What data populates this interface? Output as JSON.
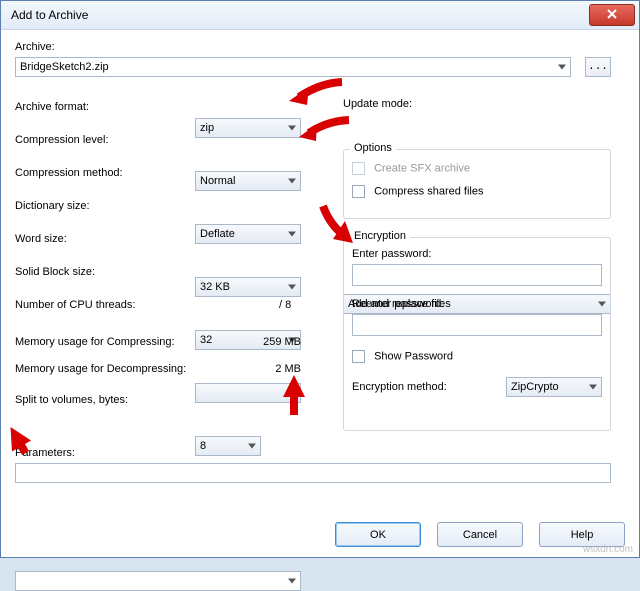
{
  "window": {
    "title": "Add to Archive"
  },
  "archive": {
    "label": "Archive:",
    "value": "BridgeSketch2.zip",
    "browse": "..."
  },
  "left": {
    "format_lbl": "Archive format:",
    "format_val": "zip",
    "level_lbl": "Compression level:",
    "level_val": "Normal",
    "method_lbl": "Compression method:",
    "method_val": "Deflate",
    "dict_lbl": "Dictionary size:",
    "dict_val": "32 KB",
    "word_lbl": "Word size:",
    "word_val": "32",
    "solid_lbl": "Solid Block size:",
    "solid_val": "",
    "cpu_lbl": "Number of CPU threads:",
    "cpu_val": "8",
    "cpu_max": "/ 8",
    "mem_c_lbl": "Memory usage for Compressing:",
    "mem_c_val": "259 MB",
    "mem_d_lbl": "Memory usage for Decompressing:",
    "mem_d_val": "2 MB",
    "split_lbl": "Split to volumes, bytes:",
    "split_val": "",
    "params_lbl": "Parameters:",
    "params_val": ""
  },
  "update": {
    "label": "Update mode:",
    "value": "Add and replace files"
  },
  "options": {
    "legend": "Options",
    "sfx": "Create SFX archive",
    "shared": "Compress shared files"
  },
  "encryption": {
    "legend": "Encryption",
    "enter": "Enter password:",
    "reenter": "Reenter password:",
    "show": "Show Password",
    "method_lbl": "Encryption method:",
    "method_val": "ZipCrypto"
  },
  "buttons": {
    "ok": "OK",
    "cancel": "Cancel",
    "help": "Help"
  },
  "watermark": "wsxdn.com"
}
